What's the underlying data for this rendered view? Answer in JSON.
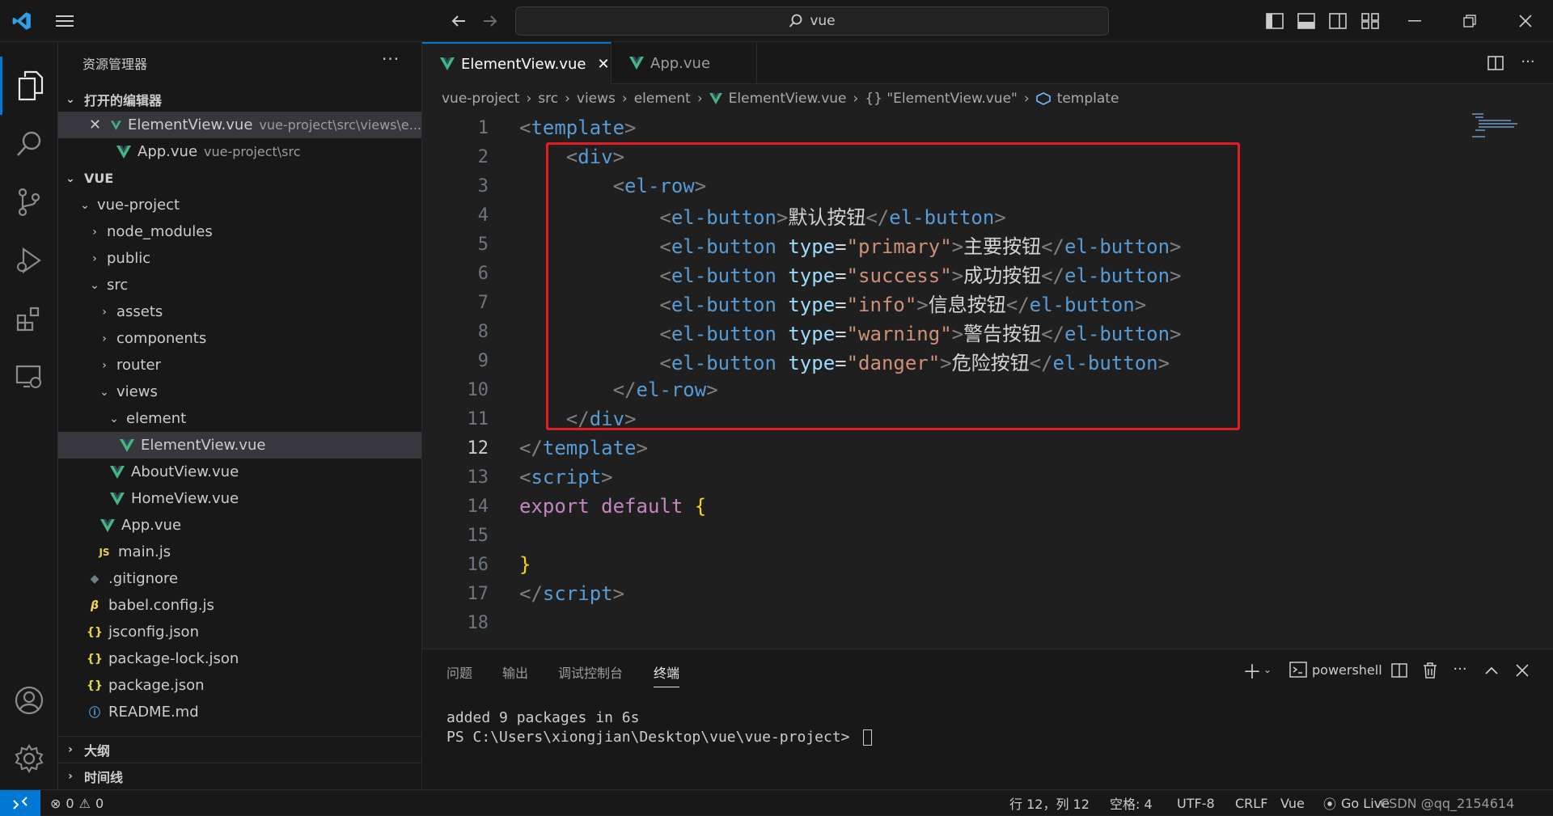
{
  "titlebar": {
    "search_text": "vue"
  },
  "sidebar": {
    "title": "资源管理器",
    "more": "···",
    "open_editors_header": "打开的编辑器",
    "open_editors": [
      {
        "name": "ElementView.vue",
        "desc": "vue-project\\src\\views\\e..."
      },
      {
        "name": "App.vue",
        "desc": "vue-project\\src"
      }
    ],
    "workspace_header": "VUE",
    "tree": [
      {
        "label": "vue-project"
      },
      {
        "label": "node_modules"
      },
      {
        "label": "public"
      },
      {
        "label": "src"
      },
      {
        "label": "assets"
      },
      {
        "label": "components"
      },
      {
        "label": "router"
      },
      {
        "label": "views"
      },
      {
        "label": "element"
      },
      {
        "label": "ElementView.vue"
      },
      {
        "label": "AboutView.vue"
      },
      {
        "label": "HomeView.vue"
      },
      {
        "label": "App.vue"
      },
      {
        "label": "main.js"
      },
      {
        "label": ".gitignore"
      },
      {
        "label": "babel.config.js"
      },
      {
        "label": "jsconfig.json"
      },
      {
        "label": "package-lock.json"
      },
      {
        "label": "package.json"
      },
      {
        "label": "README.md"
      }
    ],
    "outline_header": "大纲",
    "timeline_header": "时间线"
  },
  "tabs": [
    {
      "label": "ElementView.vue",
      "close": "✕"
    },
    {
      "label": "App.vue"
    }
  ],
  "breadcrumb": {
    "parts": [
      "vue-project",
      "src",
      "views",
      "element",
      "ElementView.vue",
      "{} \"ElementView.vue\"",
      "template"
    ]
  },
  "editor": {
    "line_numbers": [
      "1",
      "2",
      "3",
      "4",
      "5",
      "6",
      "7",
      "8",
      "9",
      "10",
      "11",
      "12",
      "13",
      "14",
      "15",
      "16",
      "17",
      "18"
    ],
    "lines": {
      "l4_text": "默认按钮",
      "l5_type": "\"primary\"",
      "l5_text": "主要按钮",
      "l6_type": "\"success\"",
      "l6_text": "成功按钮",
      "l7_type": "\"info\"",
      "l7_text": "信息按钮",
      "l8_type": "\"warning\"",
      "l8_text": "警告按钮",
      "l9_type": "\"danger\"",
      "l9_text": "危险按钮"
    }
  },
  "panel": {
    "tabs": [
      "问题",
      "输出",
      "调试控制台",
      "终端"
    ],
    "shell": "powershell",
    "terminal_lines": [
      "added 9 packages in 6s",
      "PS C:\\Users\\xiongjian\\Desktop\\vue\\vue-project> "
    ]
  },
  "status": {
    "errors": "0",
    "warnings": "0",
    "position": "行 12，列 12",
    "spaces": "空格: 4",
    "encoding": "UTF-8",
    "eol": "CRLF",
    "language": "Vue",
    "golive": "Go Live",
    "watermark": "CSDN @qq_2154614"
  },
  "colors": {
    "accent": "#0078d4",
    "highlight_box": "#e51c23",
    "vue_green": "#41b883"
  }
}
